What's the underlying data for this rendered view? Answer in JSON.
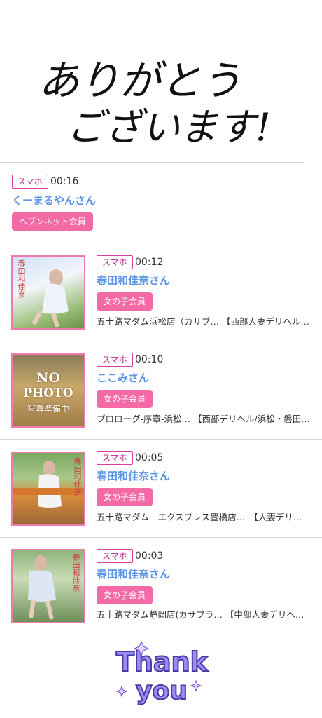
{
  "header": {
    "line1": "ありがとう",
    "line2": "ございます!"
  },
  "items": [
    {
      "device": "スマホ",
      "time": "00:16",
      "name": "くーまるやんさん",
      "member": "ヘブンネット会員",
      "shop": "",
      "has_thumb": false
    },
    {
      "device": "スマホ",
      "time": "00:12",
      "name": "春田和佳奈さん",
      "member": "女の子会員",
      "shop": "五十路マダム浜松店（カサブ… 【西部人妻デリヘル…",
      "thumb_caption": "春田和佳奈"
    },
    {
      "device": "スマホ",
      "time": "00:10",
      "name": "ここみさん",
      "member": "女の子会員",
      "shop": "プロローグ-序章-浜松… 【西部デリヘル/浜松・磐田…",
      "nophoto": [
        "NO",
        "PHOTO",
        "写真準備中"
      ]
    },
    {
      "device": "スマホ",
      "time": "00:05",
      "name": "春田和佳奈さん",
      "member": "女の子会員",
      "shop": "五十路マダム　エクスプレス豊橋店…　【人妻デリ…",
      "thumb_caption": "春田和佳奈"
    },
    {
      "device": "スマホ",
      "time": "00:03",
      "name": "春田和佳奈さん",
      "member": "女の子会員",
      "shop": "五十路マダム静岡店(カサブラ… 【中部人妻デリヘ…",
      "thumb_caption": "春田和佳奈"
    }
  ],
  "footer": {
    "line1": "Thank",
    "line2": "you"
  },
  "colors": {
    "accent": "#f36aa6",
    "name": "#5a93e6",
    "badge_border": "#d63fa1",
    "footer_text": "#8f80e8"
  }
}
